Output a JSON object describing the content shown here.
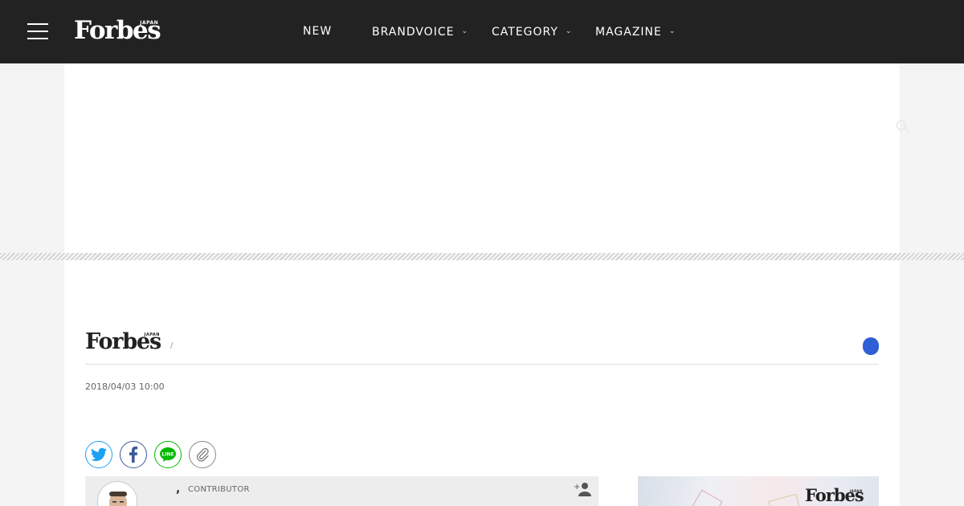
{
  "header": {
    "logo": "Forbes",
    "logo_sub": "JAPAN",
    "nav": [
      {
        "label": "NEW",
        "has_dropdown": false
      },
      {
        "label": "BRANDVOICE",
        "has_dropdown": true
      },
      {
        "label": "CATEGORY",
        "has_dropdown": true
      },
      {
        "label": "MAGAZINE",
        "has_dropdown": true
      }
    ]
  },
  "section": {
    "logo": "Forbes",
    "logo_sub": "JAPAN",
    "separator": "/"
  },
  "article": {
    "date": "2018/04/03 10:00"
  },
  "share": [
    {
      "name": "twitter",
      "icon": "twitter-icon"
    },
    {
      "name": "facebook",
      "icon": "facebook-icon"
    },
    {
      "name": "line",
      "icon": "line-icon",
      "text": "LINE"
    },
    {
      "name": "copy-link",
      "icon": "paperclip-icon"
    }
  ],
  "author": {
    "comma": ",",
    "role": "CONTRIBUTOR"
  },
  "promo": {
    "logo": "Forbes",
    "logo_sub": "JAPAN"
  },
  "colors": {
    "topbar": "#222222",
    "accent_blue": "#2f5fd6",
    "twitter": "#1da1f2",
    "facebook": "#3b5998",
    "line": "#00b900"
  }
}
